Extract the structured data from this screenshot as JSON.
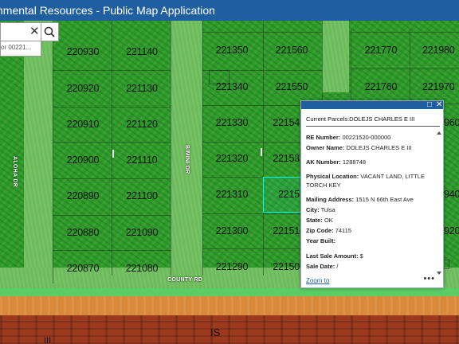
{
  "header": {
    "title": "nmental Resources - Public Map Application"
  },
  "search": {
    "value": "",
    "suggestion": "or 00221...",
    "clear_glyph": "✕"
  },
  "parcels": {
    "col1": [
      "220930",
      "220920",
      "220910",
      "220900",
      "220890",
      "220880",
      "220870"
    ],
    "col2": [
      "221140",
      "221130",
      "221120",
      "221110",
      "221100",
      "221090",
      "221080"
    ],
    "col3": [
      "221350",
      "221340",
      "221330",
      "221320",
      "221310",
      "221300",
      "221290"
    ],
    "col4": [
      "221560",
      "221550",
      "22154",
      "22153",
      "2215",
      "22151",
      "22150"
    ],
    "col5": [
      "221770",
      "221760"
    ],
    "col6": [
      "221980",
      "221970",
      "960",
      "940",
      "920"
    ]
  },
  "streets": {
    "aloha": "ALOHA DR",
    "bimini": "BIMINI DR",
    "county": "COUNTY RD"
  },
  "zones": {
    "is": "IS",
    "iii": "III"
  },
  "popup": {
    "title": "Current Parcels:DOLEJS CHARLES E III",
    "re_label": "RE Number:",
    "re_value": "00221520-000000",
    "owner_label": "Owner Name:",
    "owner_value": "DOLEJS CHARLES E III",
    "ak_label": "AK Number:",
    "ak_value": "1288748",
    "phys_label": "Physical Location:",
    "phys_value": "VACANT LAND, LITTLE TORCH KEY",
    "mail_label": "Mailing Address:",
    "mail_value": "1515 N 66th East Ave",
    "city_label": "City:",
    "city_value": "Tulsa",
    "state_label": "State:",
    "state_value": "OK",
    "zip_label": "Zip Code:",
    "zip_value": "74115",
    "year_label": "Year Built:",
    "year_value": "",
    "last_sale_label": "Last Sale Amount:",
    "last_sale_value": "$",
    "sale_date_label": "Sale Date:",
    "sale_date_value": "/",
    "zoom_label": "Zoom to",
    "more_label": "•••",
    "maximize_glyph": "□",
    "close_glyph": "✕"
  },
  "colors": {
    "header_bg": "#1f5f9f",
    "selection": "#00ffff",
    "vegetation": "#2f9a2c"
  }
}
